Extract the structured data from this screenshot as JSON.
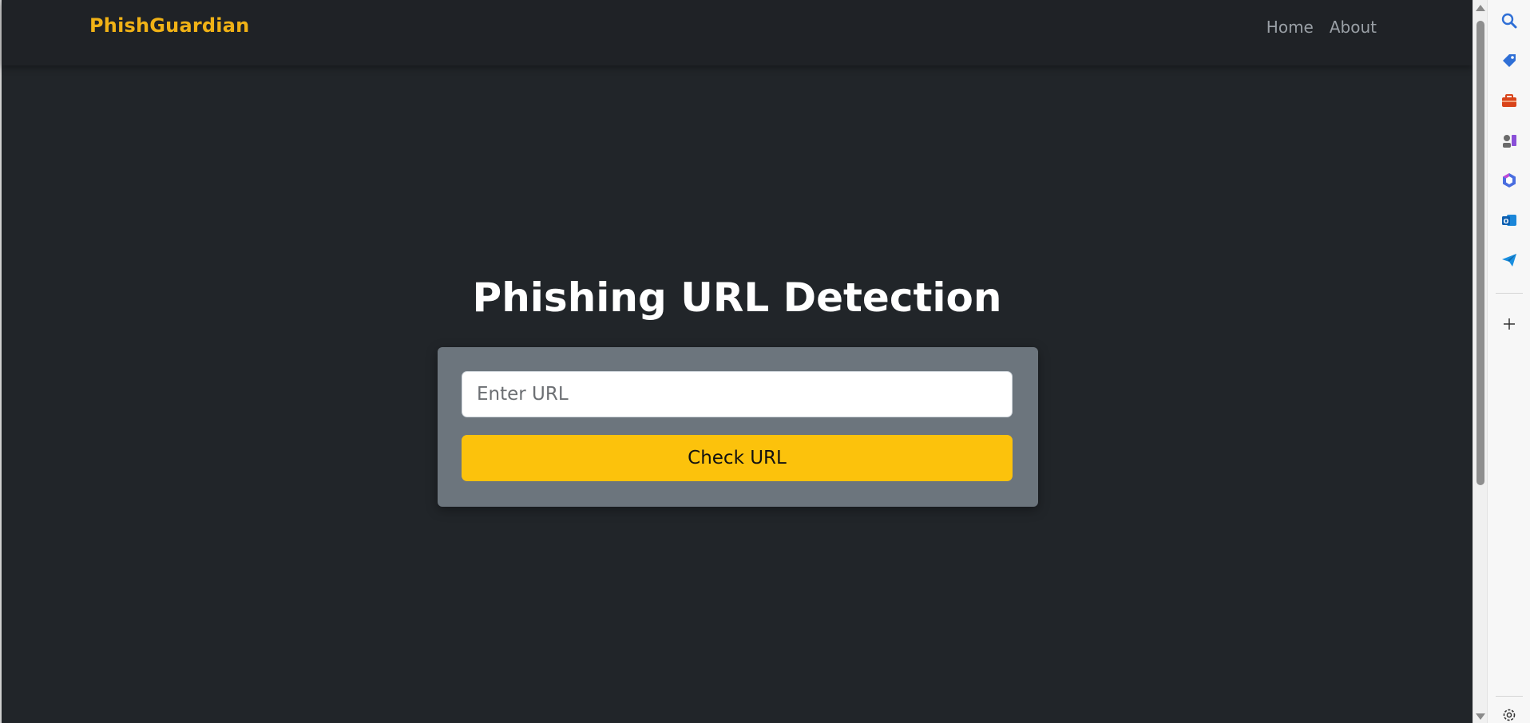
{
  "navbar": {
    "brand": "PhishGuardian",
    "links": [
      "Home",
      "About"
    ]
  },
  "main": {
    "title": "Phishing URL Detection",
    "url_input": {
      "placeholder": "Enter URL",
      "value": ""
    },
    "check_button": "Check URL"
  },
  "sidepanel": {
    "icons": [
      "search-icon",
      "tag-icon",
      "toolbox-icon",
      "chess-icon",
      "office-icon",
      "outlook-icon",
      "send-icon",
      "add-icon",
      "settings-icon"
    ]
  },
  "colors": {
    "page_bg": "#212529",
    "brand": "#f0b216",
    "card_bg": "#6c757d",
    "button_bg": "#fcc20c"
  }
}
